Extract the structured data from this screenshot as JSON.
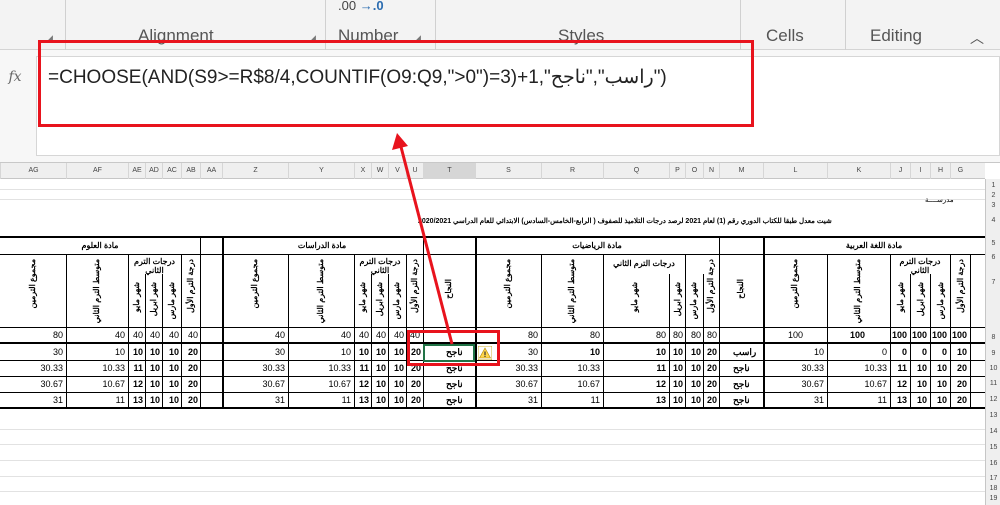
{
  "ribbon": {
    "num_format_hint": ".00",
    "num_format_arrow": "→.0",
    "groups": [
      {
        "label": "Alignment"
      },
      {
        "label": "Number"
      },
      {
        "label": "Styles"
      },
      {
        "label": "Cells"
      },
      {
        "label": "Editing"
      }
    ]
  },
  "formula_bar": {
    "fx_label": "fx",
    "formula": "=CHOOSE(AND(S9>=R$8/4,COUNTIF(O9:Q9,\">0\")=3)+1,\"راسب\",\"ناجح\")"
  },
  "columns": [
    "AG",
    "AF",
    "AE",
    "AD",
    "AC",
    "AB",
    "AA",
    "Z",
    "Y",
    "X",
    "W",
    "V",
    "U",
    "T",
    "S",
    "R",
    "Q",
    "P",
    "O",
    "N",
    "M",
    "L",
    "K",
    "J",
    "I",
    "H",
    "G"
  ],
  "rows": [
    "1",
    "2",
    "3",
    "4",
    "5",
    "6",
    "7",
    "8",
    "9",
    "10",
    "11",
    "12",
    "13",
    "14",
    "15",
    "16",
    "17",
    "18",
    "19"
  ],
  "sheet": {
    "school": "مدرســــة",
    "title": "شيت معدل طبقا للكتاب الدوري رقم (1) لعام 2021 لرصد درجات التلاميذ للصفوف ( الرابع-الخامس-السادس) الابتدائي للعام الدراسي 2020/2021",
    "sections": [
      {
        "name": "مادة  العلوم"
      },
      {
        "name": "مادة الدراسات"
      },
      {
        "name": "مادة الرياضيات"
      },
      {
        "name": "مادة اللغة العربية"
      }
    ],
    "headers": {
      "total": "مجموع الترمين",
      "avg2": "متوسط الترم الثاني",
      "term2": "درجات الترم الثاني",
      "may": "شهر مايو",
      "april": "شهر ابريل",
      "march": "شهر مارس",
      "term1": "درجة الترم الأول",
      "result": "النجاح"
    },
    "max_row": {
      "sci": [
        "80",
        "40",
        "40",
        "40",
        "40",
        "40"
      ],
      "soc": [
        "40",
        "40",
        "40",
        "40",
        "40",
        "40",
        "40"
      ],
      "math": [
        "80",
        "80",
        "80",
        "80",
        "80",
        "80"
      ],
      "ar": [
        "100",
        "100",
        "100",
        "100",
        "100",
        "100"
      ]
    },
    "data_rows": [
      {
        "sci": [
          "30",
          "10",
          "10",
          "10",
          "10",
          "20"
        ],
        "soc": [
          "30",
          "10",
          "10",
          "10",
          "10",
          "20"
        ],
        "soc_res": "ناجح",
        "math": [
          "30",
          "10",
          "10",
          "10",
          "10",
          "20"
        ],
        "math_res": "راسب",
        "ar": [
          "10",
          "0",
          "0",
          "0",
          "0",
          "10"
        ]
      },
      {
        "sci": [
          "30.33",
          "10.33",
          "11",
          "10",
          "10",
          "20"
        ],
        "soc": [
          "30.33",
          "10.33",
          "11",
          "10",
          "10",
          "20"
        ],
        "soc_res": "ناجح",
        "math": [
          "30.33",
          "10.33",
          "11",
          "10",
          "10",
          "20"
        ],
        "math_res": "ناجح",
        "ar": [
          "30.33",
          "10.33",
          "11",
          "10",
          "10",
          "20"
        ]
      },
      {
        "sci": [
          "30.67",
          "10.67",
          "12",
          "10",
          "10",
          "20"
        ],
        "soc": [
          "30.67",
          "10.67",
          "12",
          "10",
          "10",
          "20"
        ],
        "soc_res": "ناجح",
        "math": [
          "30.67",
          "10.67",
          "12",
          "10",
          "10",
          "20"
        ],
        "math_res": "ناجح",
        "ar": [
          "30.67",
          "10.67",
          "12",
          "10",
          "10",
          "20"
        ]
      },
      {
        "sci": [
          "31",
          "11",
          "13",
          "10",
          "10",
          "20"
        ],
        "soc": [
          "31",
          "11",
          "13",
          "10",
          "10",
          "20"
        ],
        "soc_res": "ناجح",
        "math": [
          "31",
          "11",
          "13",
          "10",
          "10",
          "20"
        ],
        "math_res": "ناجح",
        "ar": [
          "31",
          "11",
          "13",
          "10",
          "10",
          "20"
        ]
      }
    ]
  },
  "colors": {
    "accent_red": "#e8131d",
    "grid": "#e2e2e2"
  }
}
